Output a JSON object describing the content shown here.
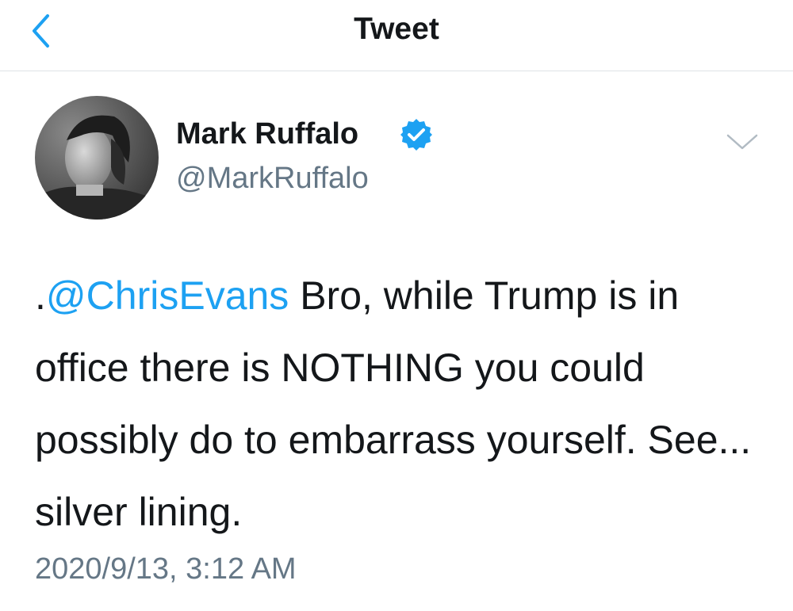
{
  "nav": {
    "title": "Tweet",
    "back_icon": "chevron-left-icon",
    "accent_color": "#1da1f2"
  },
  "author": {
    "name": "Mark Ruffalo",
    "handle": "@MarkRuffalo",
    "verified": true,
    "verified_icon": "verified-badge-icon",
    "avatar": "profile-photo"
  },
  "menu": {
    "icon": "chevron-down-icon"
  },
  "tweet": {
    "prefix": ".",
    "mention": "@ChrisEvans",
    "body": " Bro, while Trump is in office there is NOTHING you could possibly do to embarrass yourself. See... silver lining.",
    "timestamp": "2020/9/13, 3:12 AM"
  },
  "colors": {
    "text": "#14171a",
    "secondary": "#657786",
    "link": "#1da1f2",
    "divider": "#dfe3e6"
  }
}
